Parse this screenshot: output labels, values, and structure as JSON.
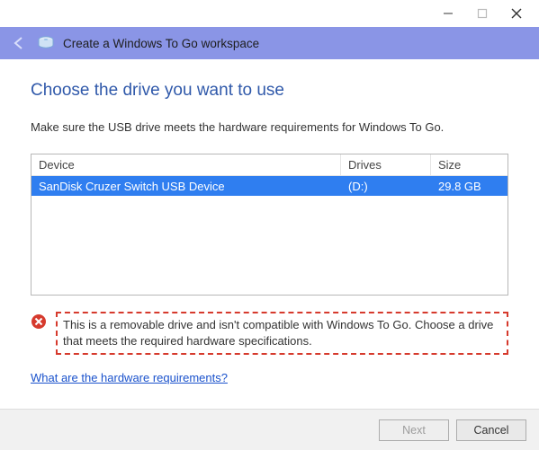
{
  "window": {
    "header_title": "Create a Windows To Go workspace"
  },
  "page": {
    "heading": "Choose the drive you want to use",
    "instruction": "Make sure the USB drive meets the hardware requirements for Windows To Go."
  },
  "table": {
    "headers": {
      "device": "Device",
      "drives": "Drives",
      "size": "Size"
    },
    "row": {
      "device": "SanDisk Cruzer Switch USB Device",
      "drives": "(D:)",
      "size": "29.8 GB"
    }
  },
  "error": {
    "text": "This is a removable drive and isn't compatible with Windows To Go. Choose a drive that meets the required hardware specifications."
  },
  "link": {
    "label": "What are the hardware requirements?"
  },
  "buttons": {
    "next": "Next",
    "cancel": "Cancel"
  }
}
